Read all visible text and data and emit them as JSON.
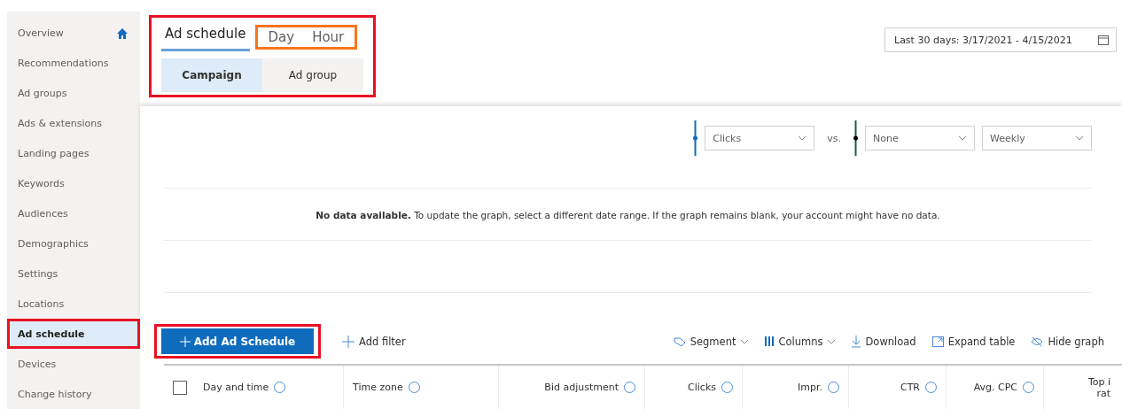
{
  "sidebar": {
    "items": [
      {
        "label": "Overview",
        "selected": false,
        "home": true,
        "outlined": false
      },
      {
        "label": "Recommendations",
        "selected": false,
        "home": false,
        "outlined": false
      },
      {
        "label": "Ad groups",
        "selected": false,
        "home": false,
        "outlined": false
      },
      {
        "label": "Ads & extensions",
        "selected": false,
        "home": false,
        "outlined": false
      },
      {
        "label": "Landing pages",
        "selected": false,
        "home": false,
        "outlined": false
      },
      {
        "label": "Keywords",
        "selected": false,
        "home": false,
        "outlined": false
      },
      {
        "label": "Audiences",
        "selected": false,
        "home": false,
        "outlined": false
      },
      {
        "label": "Demographics",
        "selected": false,
        "home": false,
        "outlined": false
      },
      {
        "label": "Settings",
        "selected": false,
        "home": false,
        "outlined": false
      },
      {
        "label": "Locations",
        "selected": false,
        "home": false,
        "outlined": false
      },
      {
        "label": "Ad schedule",
        "selected": true,
        "home": false,
        "outlined": true
      },
      {
        "label": "Devices",
        "selected": false,
        "home": false,
        "outlined": false
      },
      {
        "label": "Change history",
        "selected": false,
        "home": false,
        "outlined": false
      }
    ]
  },
  "header": {
    "outlined": true,
    "tabs": [
      {
        "label": "Ad schedule",
        "selected": true,
        "outlined": false
      },
      {
        "label": "Day",
        "selected": false,
        "outlined": true
      },
      {
        "label": "Hour",
        "selected": false,
        "outlined": true
      }
    ],
    "scope": [
      {
        "label": "Campaign",
        "selected": true
      },
      {
        "label": "Ad group",
        "selected": false
      }
    ],
    "date_range": "Last 30 days: 3/17/2021 - 4/15/2021"
  },
  "graph": {
    "metric_1": "Clicks",
    "vs": "vs.",
    "metric_2": "None",
    "period": "Weekly",
    "message": "**No data available.** To update the graph, select a different date range. If the graph remains blank, your account might have no data."
  },
  "toolbar": {
    "add_button": {
      "label": "Add Ad Schedule",
      "outlined": true
    },
    "add_filter": "Add filter",
    "actions": [
      {
        "label": "Segment",
        "kind": "segment"
      },
      {
        "label": "Columns",
        "kind": "columns"
      },
      {
        "label": "Download",
        "kind": "download"
      },
      {
        "label": "Expand table",
        "kind": "expand"
      },
      {
        "label": "Hide graph",
        "kind": "hide"
      }
    ]
  },
  "table": {
    "select_all_checked": false,
    "columns": [
      {
        "label": "Day and time"
      },
      {
        "label": "Time zone"
      },
      {
        "label": "Bid adjustment"
      },
      {
        "label": "Clicks"
      },
      {
        "label": "Impr."
      },
      {
        "label": "CTR"
      },
      {
        "label": "Avg. CPC"
      },
      {
        "label": "Top i rat",
        "cut": true
      }
    ]
  }
}
